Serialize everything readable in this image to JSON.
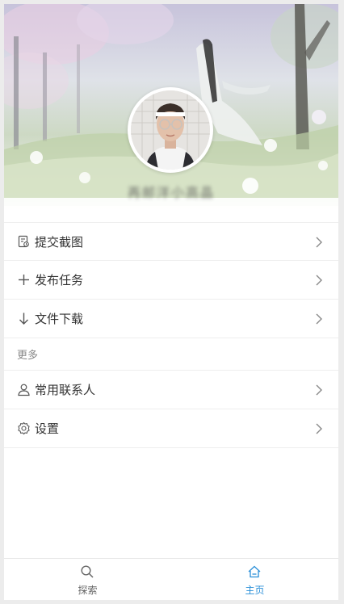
{
  "profile": {
    "username": "再邮洋小高晶",
    "avatar_icon": "avatar-photo"
  },
  "menu": {
    "items": [
      {
        "label": "提交截图",
        "icon": "screenshot-doc-icon"
      },
      {
        "label": "发布任务",
        "icon": "plus-icon"
      },
      {
        "label": "文件下载",
        "icon": "arrow-down-icon"
      }
    ],
    "section_more": "更多",
    "more_items": [
      {
        "label": "常用联系人",
        "icon": "person-icon"
      },
      {
        "label": "设置",
        "icon": "gear-icon"
      }
    ]
  },
  "tabbar": {
    "explore_label": "探索",
    "home_label": "主页",
    "active": "home"
  },
  "colors": {
    "active_tab": "#2a8fd8",
    "inactive_tab": "#666666",
    "icon_gray": "#555555"
  }
}
